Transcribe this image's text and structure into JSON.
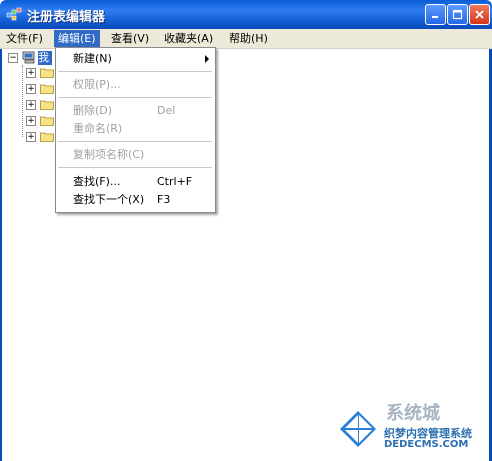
{
  "window": {
    "title": "注册表编辑器"
  },
  "menubar": {
    "items": [
      {
        "label": "文件(F)"
      },
      {
        "label": "编辑(E)"
      },
      {
        "label": "查看(V)"
      },
      {
        "label": "收藏夹(A)"
      },
      {
        "label": "帮助(H)"
      }
    ],
    "active_index": 1
  },
  "edit_menu": {
    "items": [
      {
        "label": "新建(N)",
        "shortcut": "",
        "disabled": false,
        "submenu": true
      },
      {
        "label": "权限(P)...",
        "shortcut": "",
        "disabled": true
      },
      {
        "label": "删除(D)",
        "shortcut": "Del",
        "disabled": true
      },
      {
        "label": "重命名(R)",
        "shortcut": "",
        "disabled": true
      },
      {
        "label": "复制项名称(C)",
        "shortcut": "",
        "disabled": true
      },
      {
        "label": "查找(F)...",
        "shortcut": "Ctrl+F",
        "disabled": false
      },
      {
        "label": "查找下一个(X)",
        "shortcut": "F3",
        "disabled": false
      }
    ]
  },
  "tree": {
    "root_label_visible": "我",
    "child_count": 5
  },
  "watermark": {
    "brand": "系统城",
    "line1": "织梦内容管理系统",
    "line2": "DEDECMS.COM"
  },
  "colors": {
    "titlebar": "#0a5cd8",
    "menu_highlight": "#316ac5",
    "menubar_bg": "#ece9d8",
    "disabled_text": "#a0a0a0"
  }
}
